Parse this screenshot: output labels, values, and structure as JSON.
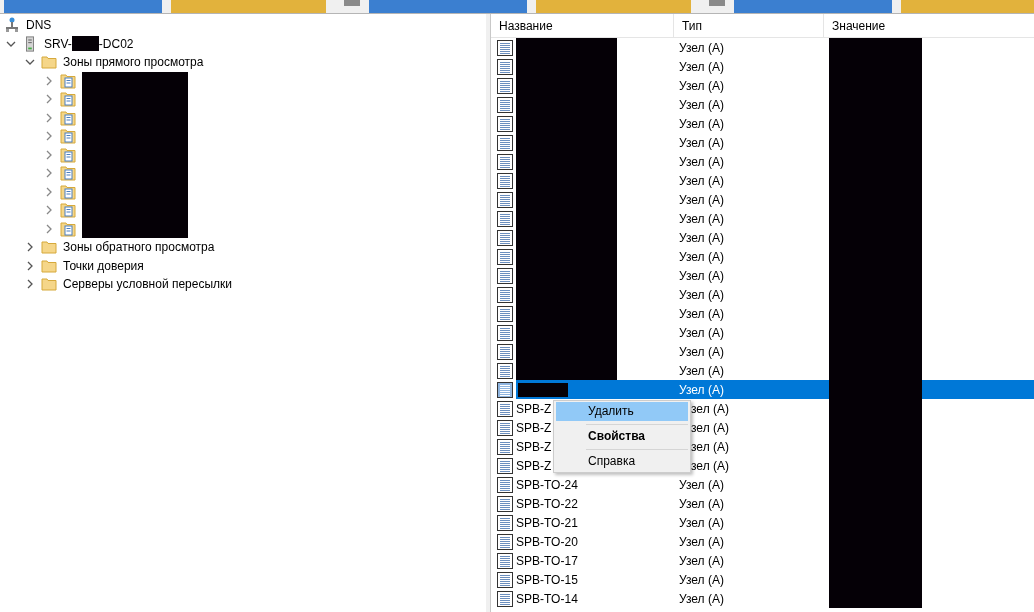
{
  "tree": {
    "label": "DNS",
    "server": {
      "name_start": "SRV-",
      "name_end": "-DC02",
      "expanded": true,
      "folders": [
        {
          "label": "Зоны прямого просмотра",
          "expanded": true,
          "children": [
            {
              "expanded": false
            },
            {
              "expanded": false
            },
            {
              "expanded": false
            },
            {
              "expanded": false
            },
            {
              "expanded": false
            },
            {
              "expanded": false
            },
            {
              "expanded": false
            },
            {
              "expanded": false
            },
            {
              "expanded": false
            }
          ]
        },
        {
          "label": "Зоны обратного просмотра",
          "expanded": false
        },
        {
          "label": "Точки доверия",
          "expanded": false
        },
        {
          "label": "Серверы условной пересылки",
          "expanded": false
        }
      ]
    }
  },
  "table": {
    "columns": [
      "Название",
      "Тип",
      "Значение"
    ],
    "rows": [
      {
        "type": "Узел (A)",
        "selected": false,
        "kind": "plain"
      },
      {
        "type": "Узел (A)",
        "selected": false,
        "kind": "plain"
      },
      {
        "type": "Узел (A)",
        "selected": false,
        "kind": "plain"
      },
      {
        "type": "Узел (A)",
        "selected": false,
        "kind": "plain"
      },
      {
        "type": "Узел (A)",
        "selected": false,
        "kind": "plain"
      },
      {
        "type": "Узел (A)",
        "selected": false,
        "kind": "plain"
      },
      {
        "type": "Узел (A)",
        "selected": false,
        "kind": "plain"
      },
      {
        "type": "Узел (A)",
        "selected": false,
        "kind": "plain"
      },
      {
        "type": "Узел (A)",
        "selected": false,
        "kind": "plain"
      },
      {
        "type": "Узел (A)",
        "selected": false,
        "kind": "plain"
      },
      {
        "type": "Узел (A)",
        "selected": false,
        "kind": "plain"
      },
      {
        "type": "Узел (A)",
        "selected": false,
        "kind": "plain"
      },
      {
        "type": "Узел (A)",
        "selected": false,
        "kind": "plain"
      },
      {
        "type": "Узел (A)",
        "selected": false,
        "kind": "plain"
      },
      {
        "type": "Узел (A)",
        "selected": false,
        "kind": "plain"
      },
      {
        "type": "Узел (A)",
        "selected": false,
        "kind": "plain"
      },
      {
        "type": "Узел (A)",
        "selected": false,
        "kind": "plain"
      },
      {
        "type": "Узел (A)",
        "selected": false,
        "kind": "plain"
      },
      {
        "type": "Узел (A)",
        "selected": true,
        "kind": "plain"
      },
      {
        "name": "SPB-Z",
        "type": "зел (A)",
        "selected": false,
        "kind": "covered"
      },
      {
        "name": "SPB-Z",
        "type": "зел (A)",
        "selected": false,
        "kind": "covered"
      },
      {
        "name": "SPB-Z",
        "type": "зел (A)",
        "selected": false,
        "kind": "covered"
      },
      {
        "name": "SPB-Z",
        "type": "зел (A)",
        "selected": false,
        "kind": "covered"
      },
      {
        "name": "SPB-TO-24",
        "type": "Узел (A)",
        "selected": false,
        "kind": "plain"
      },
      {
        "name": "SPB-TO-22",
        "type": "Узел (A)",
        "selected": false,
        "kind": "plain"
      },
      {
        "name": "SPB-TO-21",
        "type": "Узел (A)",
        "selected": false,
        "kind": "plain"
      },
      {
        "name": "SPB-TO-20",
        "type": "Узел (A)",
        "selected": false,
        "kind": "plain"
      },
      {
        "name": "SPB-TO-17",
        "type": "Узел (A)",
        "selected": false,
        "kind": "plain"
      },
      {
        "name": "SPB-TO-15",
        "type": "Узел (A)",
        "selected": false,
        "kind": "plain"
      },
      {
        "name": "SPB-TO-14",
        "type": "Узел (A)",
        "selected": false,
        "kind": "plain"
      }
    ]
  },
  "context_menu": [
    {
      "label": "Удалить",
      "selected": true,
      "bold": false
    },
    {
      "label": "Свойства",
      "selected": false,
      "bold": true
    },
    {
      "label": "Справка",
      "selected": false,
      "bold": false
    }
  ]
}
